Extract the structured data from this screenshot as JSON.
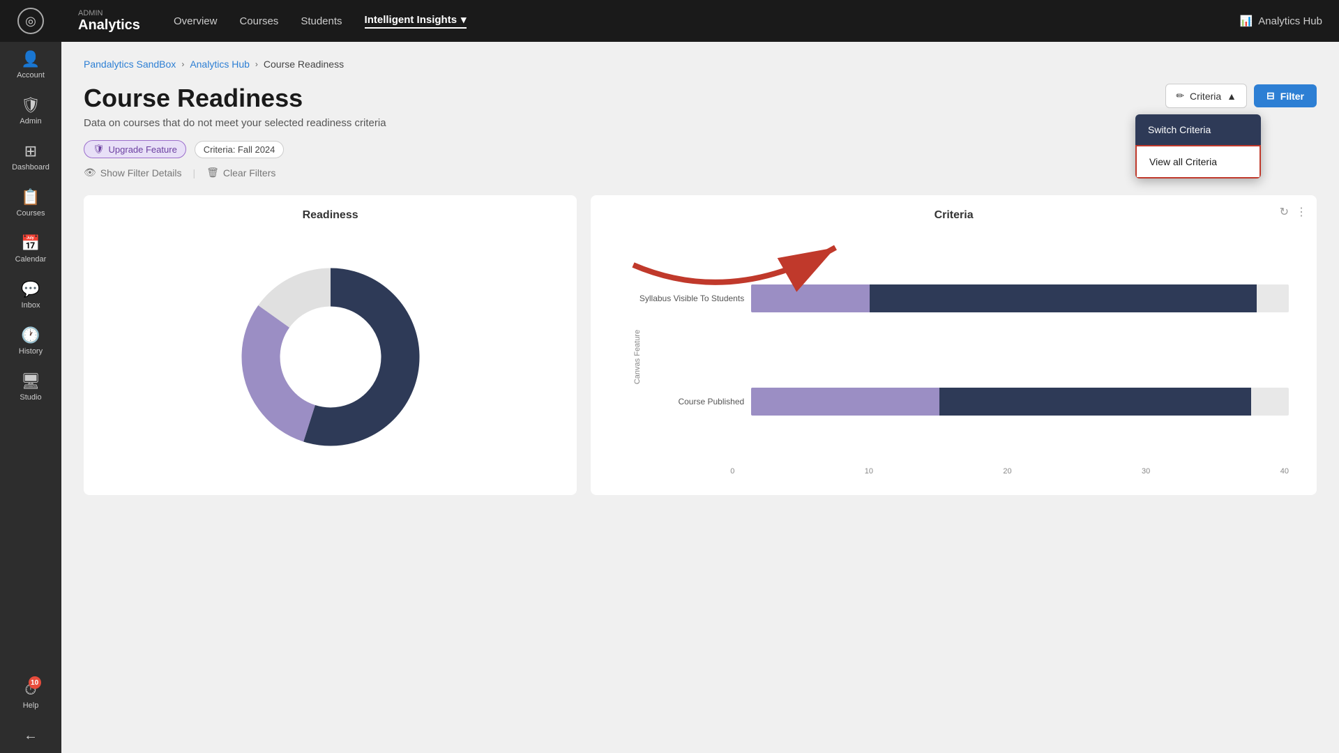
{
  "sidebar": {
    "logo_label": "◎",
    "items": [
      {
        "id": "account",
        "label": "Account",
        "icon": "👤"
      },
      {
        "id": "admin",
        "label": "Admin",
        "icon": "🛡"
      },
      {
        "id": "dashboard",
        "label": "Dashboard",
        "icon": "🏠"
      },
      {
        "id": "courses",
        "label": "Courses",
        "icon": "📋"
      },
      {
        "id": "calendar",
        "label": "Calendar",
        "icon": "📅"
      },
      {
        "id": "inbox",
        "label": "Inbox",
        "icon": "💬"
      },
      {
        "id": "history",
        "label": "History",
        "icon": "🕐"
      },
      {
        "id": "studio",
        "label": "Studio",
        "icon": "🖥"
      },
      {
        "id": "help",
        "label": "Help",
        "icon": "⏱",
        "badge": "10"
      }
    ],
    "collapse_icon": "←"
  },
  "topnav": {
    "brand_admin": "ADMIN",
    "brand_name": "Analytics",
    "links": [
      {
        "id": "overview",
        "label": "Overview",
        "active": false
      },
      {
        "id": "courses",
        "label": "Courses",
        "active": false
      },
      {
        "id": "students",
        "label": "Students",
        "active": false
      },
      {
        "id": "insights",
        "label": "Intelligent Insights",
        "active": true
      }
    ],
    "analytics_hub_label": "Analytics Hub",
    "analytics_hub_icon": "📊"
  },
  "breadcrumb": {
    "pandalytics": "Pandalytics SandBox",
    "analytics_hub": "Analytics Hub",
    "current": "Course Readiness"
  },
  "page": {
    "title": "Course Readiness",
    "subtitle": "Data on courses that do not meet your selected readiness criteria",
    "criteria_label": "Criteria",
    "filter_label": "Filter",
    "criteria_chevron": "▲",
    "upgrade_label": "Upgrade Feature",
    "criteria_tag": "Criteria: Fall 2024",
    "show_filter_label": "Show Filter Details",
    "clear_filter_label": "Clear Filters"
  },
  "dropdown": {
    "switch_criteria": "Switch Criteria",
    "view_all_criteria": "View all Criteria"
  },
  "charts": {
    "readiness": {
      "title": "Readiness",
      "donut": {
        "dark_percent": 55,
        "light_percent": 30,
        "gray_percent": 15
      }
    },
    "criteria": {
      "title": "Criteria",
      "y_axis_label": "Canvas Feature",
      "bars": [
        {
          "label": "Syllabus Visible To Students",
          "light_width_pct": 22,
          "dark_start_pct": 22,
          "dark_width_pct": 75
        },
        {
          "label": "Course Published",
          "light_width_pct": 35,
          "dark_start_pct": 35,
          "dark_width_pct": 60
        }
      ],
      "x_axis": [
        "0",
        "10",
        "20",
        "30",
        "40"
      ]
    }
  }
}
